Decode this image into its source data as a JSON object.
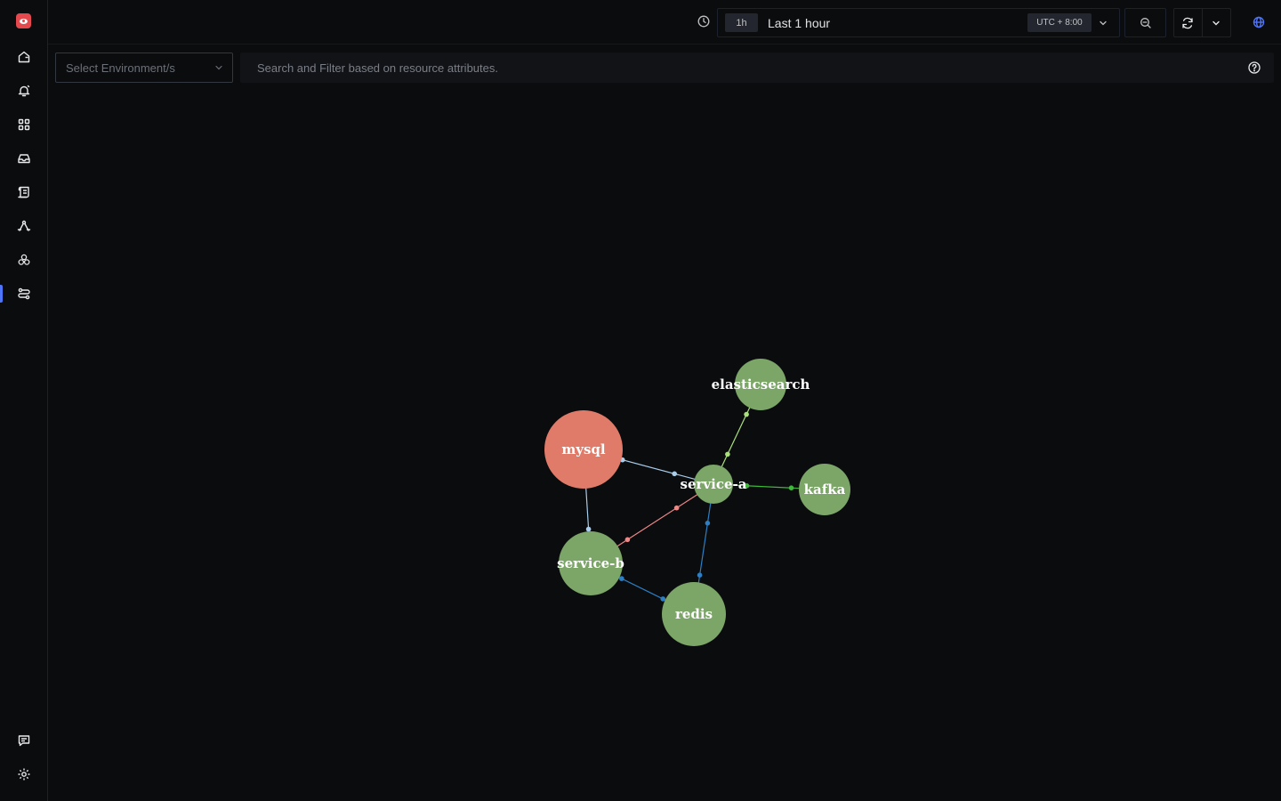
{
  "sidebar": {
    "logo_icon": "signoz-logo-icon",
    "items": [
      {
        "icon": "home-icon",
        "active": false
      },
      {
        "icon": "bell-alerts-icon",
        "active": false
      },
      {
        "icon": "dashboard-grid-icon",
        "active": false
      },
      {
        "icon": "inbox-icon",
        "active": false
      },
      {
        "icon": "scroll-logs-icon",
        "active": false
      },
      {
        "icon": "traces-icon",
        "active": false
      },
      {
        "icon": "services-hexagon-icon",
        "active": false
      },
      {
        "icon": "service-map-icon",
        "active": true
      }
    ],
    "bottom": [
      {
        "icon": "chat-support-icon"
      },
      {
        "icon": "settings-gear-icon"
      }
    ]
  },
  "topbar": {
    "time_range_short": "1h",
    "time_range_label": "Last 1 hour",
    "timezone": "UTC + 8:00"
  },
  "filters": {
    "environment_placeholder": "Select Environment/s",
    "search_placeholder": "Search and Filter based on resource attributes."
  },
  "colors": {
    "accent": "#4e74f8",
    "node_ok": "#7ca568",
    "node_error": "#e07b6a"
  },
  "service_map": {
    "nodes": [
      {
        "id": "elasticsearch",
        "label": "elasticsearch",
        "status": "ok"
      },
      {
        "id": "mysql",
        "label": "mysql",
        "status": "error"
      },
      {
        "id": "service-a",
        "label": "service-a",
        "status": "ok"
      },
      {
        "id": "kafka",
        "label": "kafka",
        "status": "ok"
      },
      {
        "id": "service-b",
        "label": "service-b",
        "status": "ok"
      },
      {
        "id": "redis",
        "label": "redis",
        "status": "ok"
      }
    ],
    "edges": [
      {
        "source": "service-a",
        "target": "elasticsearch",
        "color": "#a9e07c"
      },
      {
        "source": "service-a",
        "target": "mysql",
        "color": "#a9cdea"
      },
      {
        "source": "service-a",
        "target": "kafka",
        "color": "#3db83a"
      },
      {
        "source": "service-b",
        "target": "service-a",
        "color": "#ee8888"
      },
      {
        "source": "service-b",
        "target": "mysql",
        "color": "#a9cdea"
      },
      {
        "source": "service-a",
        "target": "redis",
        "color": "#2c7fc4"
      },
      {
        "source": "service-b",
        "target": "redis",
        "color": "#2c7fc4"
      }
    ]
  }
}
